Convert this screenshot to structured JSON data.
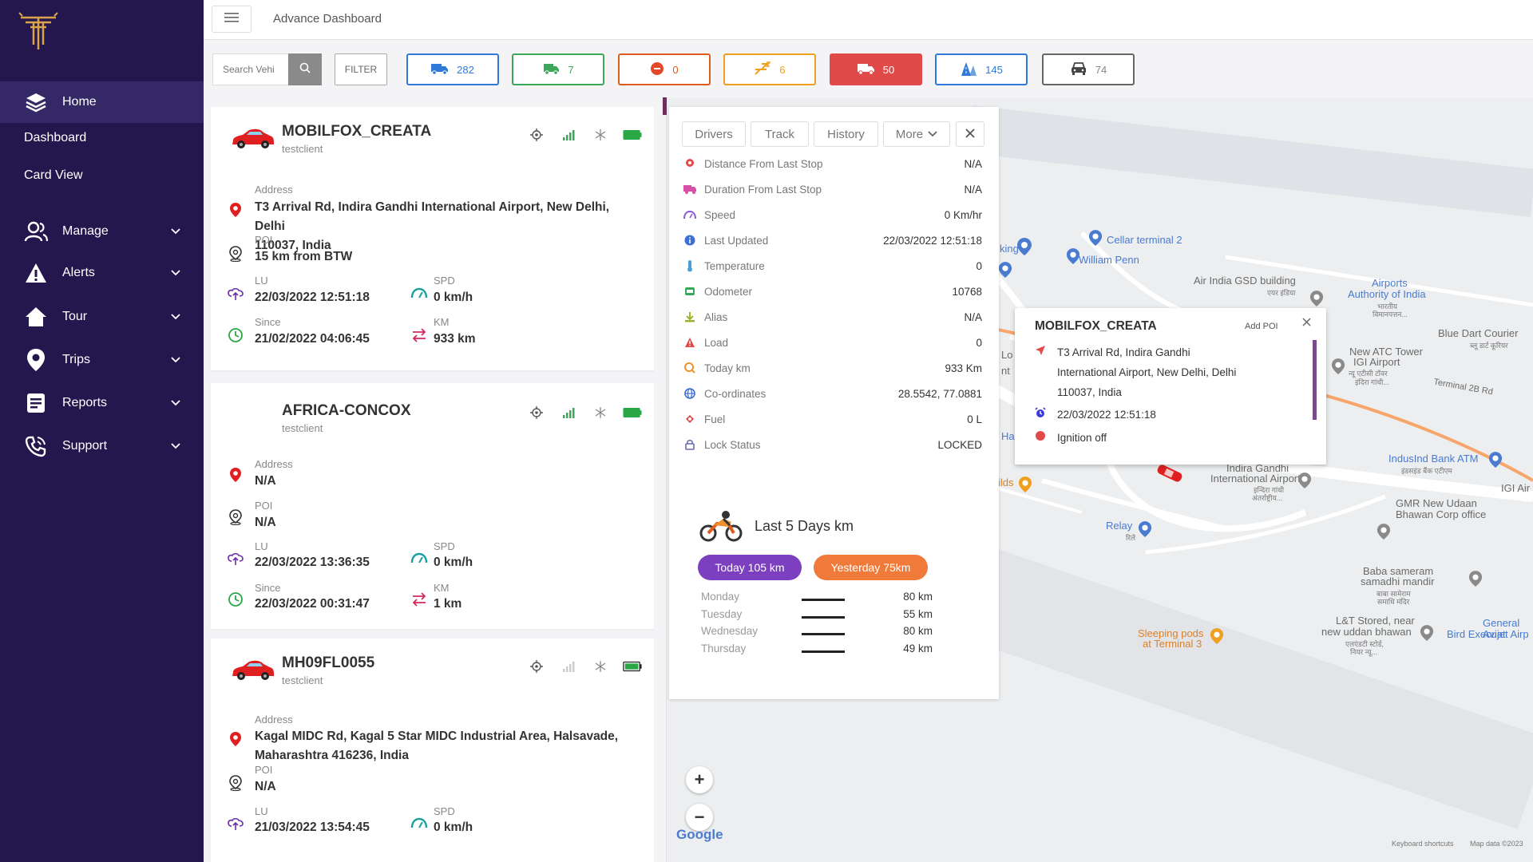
{
  "sidebar": {
    "items": [
      {
        "label": "Home"
      },
      {
        "label": "Dashboard"
      },
      {
        "label": "Card View"
      },
      {
        "label": "Manage"
      },
      {
        "label": "Alerts"
      },
      {
        "label": "Tour"
      },
      {
        "label": "Trips"
      },
      {
        "label": "Reports"
      },
      {
        "label": "Support"
      }
    ]
  },
  "header": {
    "title": "Advance Dashboard"
  },
  "filterbar": {
    "search_placeholder": "Search Vehi",
    "filter_label": "FILTER",
    "stats": [
      {
        "value": "282",
        "color": "#2f7ad6",
        "icon": "truck-icon"
      },
      {
        "value": "7",
        "color": "#3aa75a",
        "icon": "truck-moving-icon"
      },
      {
        "value": "0",
        "color": "#e05a1e",
        "icon": "stop-icon"
      },
      {
        "value": "6",
        "color": "#f0a020",
        "icon": "sleep-icon"
      },
      {
        "value": "50",
        "color": "#e24a4a",
        "icon": "truck-alert-icon"
      },
      {
        "value": "145",
        "color": "#2f7ad6",
        "icon": "road-icon"
      },
      {
        "value": "74",
        "color": "#666666",
        "icon": "car-icon"
      }
    ]
  },
  "vehicles": [
    {
      "name": "MOBILFOX_CREATA",
      "client": "testclient",
      "address_label": "Address",
      "address_line1": "T3 Arrival Rd, Indira Gandhi International Airport, New Delhi, Delhi",
      "address_line2": "110037, India",
      "poi_label": "POI",
      "poi": "15 km from BTW",
      "lu_label": "LU",
      "lu": "22/03/2022 12:51:18",
      "spd_label": "SPD",
      "spd": "0 km/h",
      "since_label": "Since",
      "since": "21/02/2022 04:06:45",
      "km_label": "KM",
      "km": "933 km"
    },
    {
      "name": "AFRICA-CONCOX",
      "client": "testclient",
      "address_label": "Address",
      "address_line1": "N/A",
      "poi_label": "POI",
      "poi": "N/A",
      "lu_label": "LU",
      "lu": "22/03/2022 13:36:35",
      "spd_label": "SPD",
      "spd": "0 km/h",
      "since_label": "Since",
      "since": "22/03/2022 00:31:47",
      "km_label": "KM",
      "km": "1 km"
    },
    {
      "name": "MH09FL0055",
      "client": "testclient",
      "address_label": "Address",
      "address_line1": "Kagal MIDC Rd, Kagal 5 Star MIDC Industrial Area, Halsavade,",
      "address_line2": "Maharashtra 416236, India",
      "poi_label": "POI",
      "poi": "N/A",
      "lu_label": "LU",
      "lu": "21/03/2022 13:54:45",
      "spd_label": "SPD",
      "spd": "0 km/h"
    }
  ],
  "details": {
    "tabs": [
      "Drivers",
      "Track",
      "History",
      "More"
    ],
    "rows": [
      {
        "label": "Distance From Last Stop",
        "value": "N/A",
        "icon": "pin-icon",
        "color": "#e24a4a"
      },
      {
        "label": "Duration From Last Stop",
        "value": "N/A",
        "icon": "truck-icon",
        "color": "#d84fa8"
      },
      {
        "label": "Speed",
        "value": "0 Km/hr",
        "icon": "speed-icon",
        "color": "#8a5ad6"
      },
      {
        "label": "Last Updated",
        "value": "22/03/2022 12:51:18",
        "icon": "info-icon",
        "color": "#3b6fd6"
      },
      {
        "label": "Temperature",
        "value": "0",
        "icon": "thermometer-icon",
        "color": "#4aa0d6"
      },
      {
        "label": "Odometer",
        "value": "10768",
        "icon": "odometer-icon",
        "color": "#3aa75a"
      },
      {
        "label": "Alias",
        "value": "N/A",
        "icon": "alias-icon",
        "color": "#9ab52c"
      },
      {
        "label": "Load",
        "value": "0",
        "icon": "warning-icon",
        "color": "#e24a4a"
      },
      {
        "label": "Today km",
        "value": "933 Km",
        "icon": "today-icon",
        "color": "#f0902c"
      },
      {
        "label": "Co-ordinates",
        "value": "28.5542, 77.0881",
        "icon": "globe-icon",
        "color": "#3b6fd6"
      },
      {
        "label": "Fuel",
        "value": "0 L",
        "icon": "fuel-icon",
        "color": "#e24a4a"
      },
      {
        "label": "Lock Status",
        "value": "LOCKED",
        "icon": "lock-icon",
        "color": "#6a6ab0"
      }
    ],
    "last5_title": "Last 5 Days km",
    "today_pill": "Today 105 km",
    "yesterday_pill": "Yesterday 75km",
    "days": [
      {
        "day": "Monday",
        "km": "80 km"
      },
      {
        "day": "Tuesday",
        "km": "55 km"
      },
      {
        "day": "Wednesday",
        "km": "80 km"
      },
      {
        "day": "Thursday",
        "km": "49 km"
      }
    ]
  },
  "infowindow": {
    "title": "MOBILFOX_CREATA",
    "add_poi": "Add POI",
    "address_line1": "T3 Arrival Rd, Indira Gandhi",
    "address_line2": "International Airport, New Delhi, Delhi",
    "address_line3": "110037, India",
    "time": "22/03/2022 12:51:18",
    "ignition": "Ignition off"
  },
  "map": {
    "labels": {
      "cellar": "Cellar terminal 2",
      "william": "William Penn",
      "king": "king",
      "airindia": "Air India GSD building",
      "airindia_hi": "एयर इंडिया",
      "airports_auth": "Airports",
      "airports_auth2": "Authority of India",
      "airports_auth_hi": "भारतीय",
      "airports_auth_hi2": "विमानपत्तन...",
      "bluedart": "Blue Dart Courier",
      "bluedart_hi": "ब्लू डार्ट कूरियर",
      "atc": "New ATC Tower",
      "atc2": "IGI Airport",
      "atc_hi": "न्यू एटीसी टॉवर",
      "atc_hi2": "इंदिरा गांधी...",
      "terminal2b": "Terminal 2B Rd",
      "indusind": "IndusInd Bank ATM",
      "indusind_hi": "इंडसइंड बैंक एटीएम",
      "igiair": "IGI Air",
      "igi": "Indira Gandhi",
      "igi2": "International Airport",
      "igi_hi": "इन्दिरा गांधी",
      "igi_hi2": "अंतर्राष्ट्रीय...",
      "gmr": "GMR New Udaan",
      "gmr2": "Bhawan Corp office",
      "relay": "Relay",
      "relay_hi": "रिले",
      "baba": "Baba sameram",
      "baba2": "samadhi mandir",
      "baba_hi": "बाबा सामेराम",
      "baba_hi2": "समाधि मंदिर",
      "lt": "L&T Stored, near",
      "lt2": "new uddan bhawan",
      "lt_hi": "एलएंडटी स्टोर्ड,",
      "lt_hi2": "नियर न्यू...",
      "general": "General Aviat",
      "birdexec": "Bird Execujet Airp",
      "sleeping": "Sleeping pods",
      "sleeping2": "at Terminal 3",
      "lo": "Lo",
      "nt": "nt",
      "ha": "Ha",
      "ilds": "ilds",
      "google": "Google",
      "shortcuts": "Keyboard shortcuts",
      "mapdata": "Map data ©2023"
    }
  }
}
